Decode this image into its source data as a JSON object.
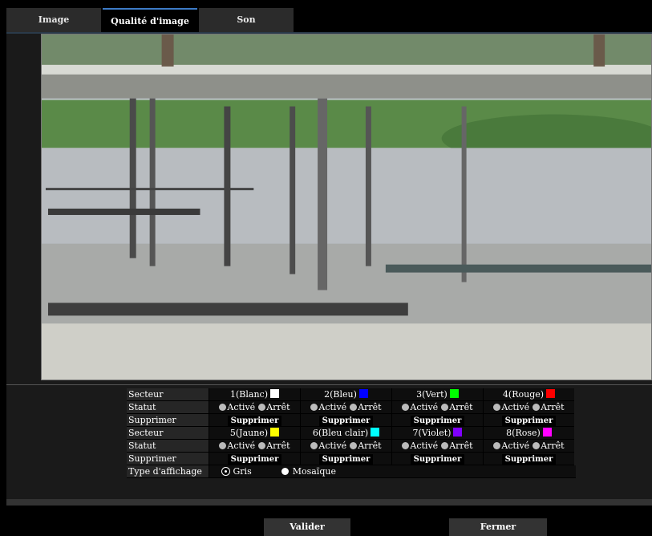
{
  "tabs": [
    {
      "label": "Image"
    },
    {
      "label": "Qualité d'image"
    },
    {
      "label": "Son"
    }
  ],
  "settings": {
    "secteur_label": "Secteur",
    "statut_label": "Statut",
    "supprimer_label": "Supprimer",
    "type_label": "Type d'affichage",
    "on_label": "Activé",
    "off_label": "Arrêt",
    "delete_btn": "Supprimer",
    "zones": [
      {
        "name": "1(Blanc)",
        "color": "#ffffff"
      },
      {
        "name": "2(Bleu)",
        "color": "#0000ff"
      },
      {
        "name": "3(Vert)",
        "color": "#00ff00"
      },
      {
        "name": "4(Rouge)",
        "color": "#ff0000"
      },
      {
        "name": "5(Jaune)",
        "color": "#ffff00"
      },
      {
        "name": "6(Bleu clair)",
        "color": "#00ffff"
      },
      {
        "name": "7(Violet)",
        "color": "#8000ff"
      },
      {
        "name": "8(Rose)",
        "color": "#ff00ff"
      }
    ],
    "display_type": {
      "gris": "Gris",
      "mosaique": "Mosaïque",
      "selected": "Gris"
    }
  },
  "buttons": {
    "valider": "Valider",
    "fermer": "Fermer"
  }
}
